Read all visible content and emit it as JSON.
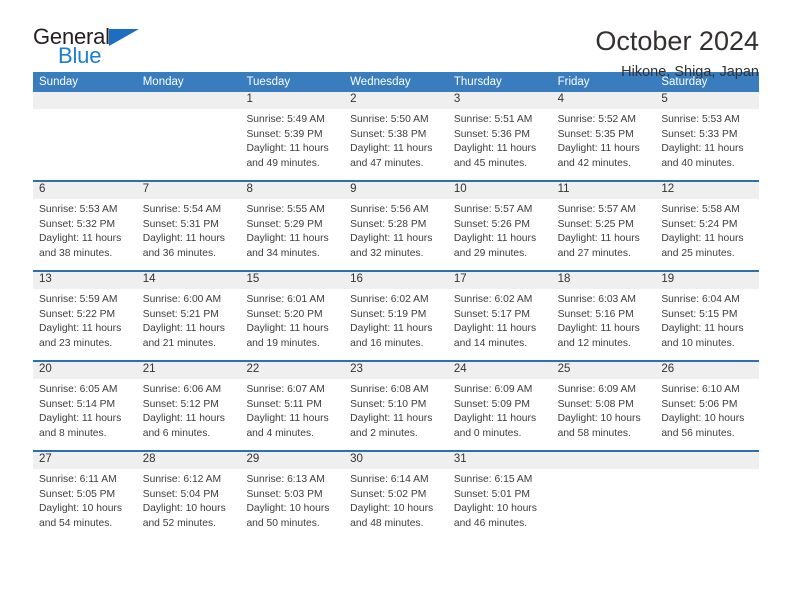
{
  "brand": {
    "name_part1": "General",
    "name_part2": "Blue",
    "color_dark": "#231f20",
    "color_blue": "#1b7fd4"
  },
  "header": {
    "title": "October 2024",
    "subtitle": "Hikone, Shiga, Japan"
  },
  "theme": {
    "header_blue": "#3a7dbf",
    "separator_blue": "#2f6fad",
    "date_band_gray": "#efefef"
  },
  "calendar": {
    "day_headers": [
      "Sunday",
      "Monday",
      "Tuesday",
      "Wednesday",
      "Thursday",
      "Friday",
      "Saturday"
    ],
    "weeks": [
      [
        {
          "date": "",
          "lines": []
        },
        {
          "date": "",
          "lines": []
        },
        {
          "date": "1",
          "lines": [
            "Sunrise: 5:49 AM",
            "Sunset: 5:39 PM",
            "Daylight: 11 hours",
            "and 49 minutes."
          ]
        },
        {
          "date": "2",
          "lines": [
            "Sunrise: 5:50 AM",
            "Sunset: 5:38 PM",
            "Daylight: 11 hours",
            "and 47 minutes."
          ]
        },
        {
          "date": "3",
          "lines": [
            "Sunrise: 5:51 AM",
            "Sunset: 5:36 PM",
            "Daylight: 11 hours",
            "and 45 minutes."
          ]
        },
        {
          "date": "4",
          "lines": [
            "Sunrise: 5:52 AM",
            "Sunset: 5:35 PM",
            "Daylight: 11 hours",
            "and 42 minutes."
          ]
        },
        {
          "date": "5",
          "lines": [
            "Sunrise: 5:53 AM",
            "Sunset: 5:33 PM",
            "Daylight: 11 hours",
            "and 40 minutes."
          ]
        }
      ],
      [
        {
          "date": "6",
          "lines": [
            "Sunrise: 5:53 AM",
            "Sunset: 5:32 PM",
            "Daylight: 11 hours",
            "and 38 minutes."
          ]
        },
        {
          "date": "7",
          "lines": [
            "Sunrise: 5:54 AM",
            "Sunset: 5:31 PM",
            "Daylight: 11 hours",
            "and 36 minutes."
          ]
        },
        {
          "date": "8",
          "lines": [
            "Sunrise: 5:55 AM",
            "Sunset: 5:29 PM",
            "Daylight: 11 hours",
            "and 34 minutes."
          ]
        },
        {
          "date": "9",
          "lines": [
            "Sunrise: 5:56 AM",
            "Sunset: 5:28 PM",
            "Daylight: 11 hours",
            "and 32 minutes."
          ]
        },
        {
          "date": "10",
          "lines": [
            "Sunrise: 5:57 AM",
            "Sunset: 5:26 PM",
            "Daylight: 11 hours",
            "and 29 minutes."
          ]
        },
        {
          "date": "11",
          "lines": [
            "Sunrise: 5:57 AM",
            "Sunset: 5:25 PM",
            "Daylight: 11 hours",
            "and 27 minutes."
          ]
        },
        {
          "date": "12",
          "lines": [
            "Sunrise: 5:58 AM",
            "Sunset: 5:24 PM",
            "Daylight: 11 hours",
            "and 25 minutes."
          ]
        }
      ],
      [
        {
          "date": "13",
          "lines": [
            "Sunrise: 5:59 AM",
            "Sunset: 5:22 PM",
            "Daylight: 11 hours",
            "and 23 minutes."
          ]
        },
        {
          "date": "14",
          "lines": [
            "Sunrise: 6:00 AM",
            "Sunset: 5:21 PM",
            "Daylight: 11 hours",
            "and 21 minutes."
          ]
        },
        {
          "date": "15",
          "lines": [
            "Sunrise: 6:01 AM",
            "Sunset: 5:20 PM",
            "Daylight: 11 hours",
            "and 19 minutes."
          ]
        },
        {
          "date": "16",
          "lines": [
            "Sunrise: 6:02 AM",
            "Sunset: 5:19 PM",
            "Daylight: 11 hours",
            "and 16 minutes."
          ]
        },
        {
          "date": "17",
          "lines": [
            "Sunrise: 6:02 AM",
            "Sunset: 5:17 PM",
            "Daylight: 11 hours",
            "and 14 minutes."
          ]
        },
        {
          "date": "18",
          "lines": [
            "Sunrise: 6:03 AM",
            "Sunset: 5:16 PM",
            "Daylight: 11 hours",
            "and 12 minutes."
          ]
        },
        {
          "date": "19",
          "lines": [
            "Sunrise: 6:04 AM",
            "Sunset: 5:15 PM",
            "Daylight: 11 hours",
            "and 10 minutes."
          ]
        }
      ],
      [
        {
          "date": "20",
          "lines": [
            "Sunrise: 6:05 AM",
            "Sunset: 5:14 PM",
            "Daylight: 11 hours",
            "and 8 minutes."
          ]
        },
        {
          "date": "21",
          "lines": [
            "Sunrise: 6:06 AM",
            "Sunset: 5:12 PM",
            "Daylight: 11 hours",
            "and 6 minutes."
          ]
        },
        {
          "date": "22",
          "lines": [
            "Sunrise: 6:07 AM",
            "Sunset: 5:11 PM",
            "Daylight: 11 hours",
            "and 4 minutes."
          ]
        },
        {
          "date": "23",
          "lines": [
            "Sunrise: 6:08 AM",
            "Sunset: 5:10 PM",
            "Daylight: 11 hours",
            "and 2 minutes."
          ]
        },
        {
          "date": "24",
          "lines": [
            "Sunrise: 6:09 AM",
            "Sunset: 5:09 PM",
            "Daylight: 11 hours",
            "and 0 minutes."
          ]
        },
        {
          "date": "25",
          "lines": [
            "Sunrise: 6:09 AM",
            "Sunset: 5:08 PM",
            "Daylight: 10 hours",
            "and 58 minutes."
          ]
        },
        {
          "date": "26",
          "lines": [
            "Sunrise: 6:10 AM",
            "Sunset: 5:06 PM",
            "Daylight: 10 hours",
            "and 56 minutes."
          ]
        }
      ],
      [
        {
          "date": "27",
          "lines": [
            "Sunrise: 6:11 AM",
            "Sunset: 5:05 PM",
            "Daylight: 10 hours",
            "and 54 minutes."
          ]
        },
        {
          "date": "28",
          "lines": [
            "Sunrise: 6:12 AM",
            "Sunset: 5:04 PM",
            "Daylight: 10 hours",
            "and 52 minutes."
          ]
        },
        {
          "date": "29",
          "lines": [
            "Sunrise: 6:13 AM",
            "Sunset: 5:03 PM",
            "Daylight: 10 hours",
            "and 50 minutes."
          ]
        },
        {
          "date": "30",
          "lines": [
            "Sunrise: 6:14 AM",
            "Sunset: 5:02 PM",
            "Daylight: 10 hours",
            "and 48 minutes."
          ]
        },
        {
          "date": "31",
          "lines": [
            "Sunrise: 6:15 AM",
            "Sunset: 5:01 PM",
            "Daylight: 10 hours",
            "and 46 minutes."
          ]
        },
        {
          "date": "",
          "lines": []
        },
        {
          "date": "",
          "lines": []
        }
      ]
    ]
  }
}
